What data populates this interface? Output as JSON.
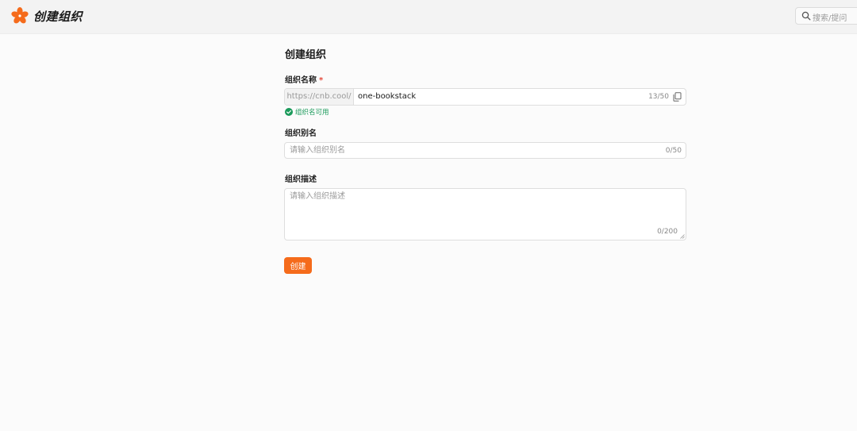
{
  "header": {
    "title": "创建组织",
    "logo_icon": "cnb-logo-icon",
    "brand_color": "#f56b1b",
    "search": {
      "placeholder": "搜索/提问",
      "icon": "search-icon"
    }
  },
  "form": {
    "title": "创建组织",
    "name_field": {
      "label": "组织名称",
      "required_mark": "*",
      "prefix": "https://cnb.cool/",
      "value": "one-bookstack",
      "counter": "13/50",
      "copy_icon": "copy-icon",
      "validation": {
        "icon": "check-circle-icon",
        "text": "组织名可用",
        "color": "#1a9a5a"
      }
    },
    "alias_field": {
      "label": "组织别名",
      "placeholder": "请输入组织别名",
      "counter": "0/50"
    },
    "description_field": {
      "label": "组织描述",
      "placeholder": "请输入组织描述",
      "counter": "0/200"
    },
    "submit_label": "创建"
  }
}
